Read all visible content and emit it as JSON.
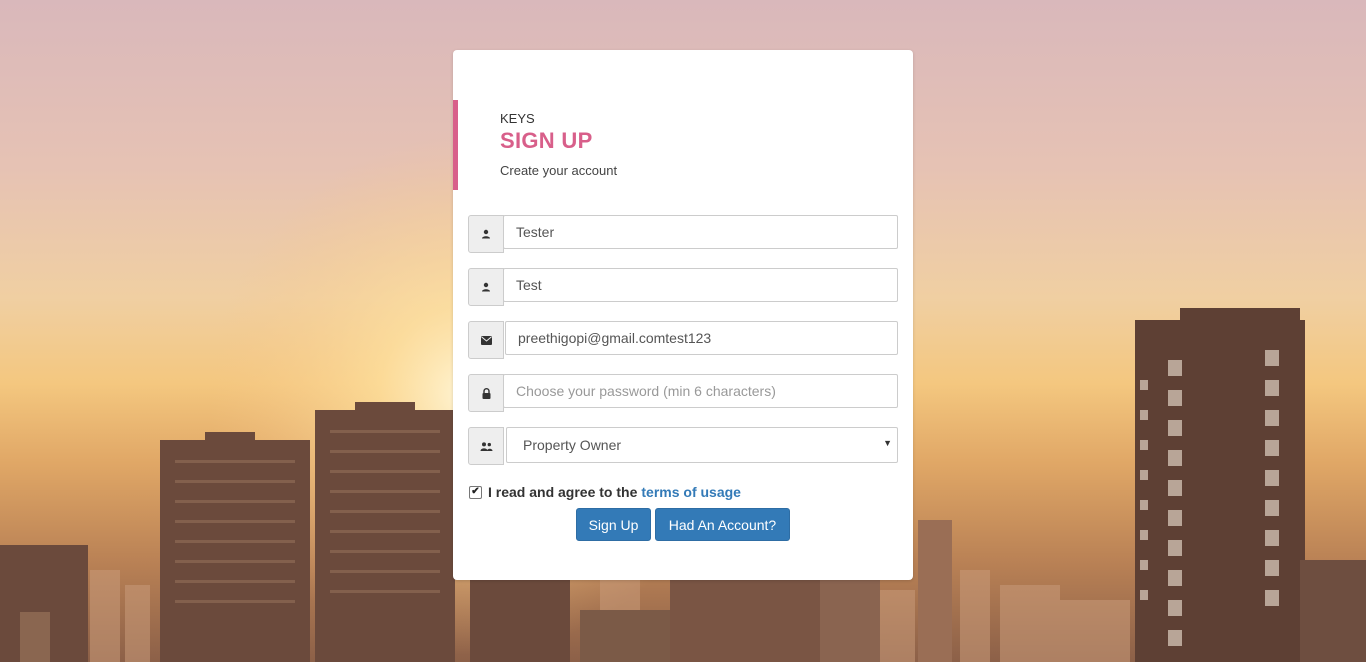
{
  "header": {
    "brand": "KEYS",
    "title": "SIGN UP",
    "subtitle": "Create your account"
  },
  "form": {
    "first_name": {
      "value": "Tester",
      "icon": "user-icon"
    },
    "last_name": {
      "value": "Test",
      "icon": "user-icon"
    },
    "email": {
      "value": "preethigopi@gmail.comtest123",
      "icon": "envelope-icon"
    },
    "password": {
      "value": "",
      "placeholder": "Choose your password (min 6 characters)",
      "icon": "lock-icon"
    },
    "role": {
      "selected": "Property Owner",
      "icon": "users-icon"
    }
  },
  "terms": {
    "checked": true,
    "text": "I read and agree to the",
    "link": "terms of usage"
  },
  "buttons": {
    "signup": "Sign Up",
    "login": "Had An Account?"
  },
  "colors": {
    "accent": "#d85f8a",
    "primary": "#337ab7"
  }
}
